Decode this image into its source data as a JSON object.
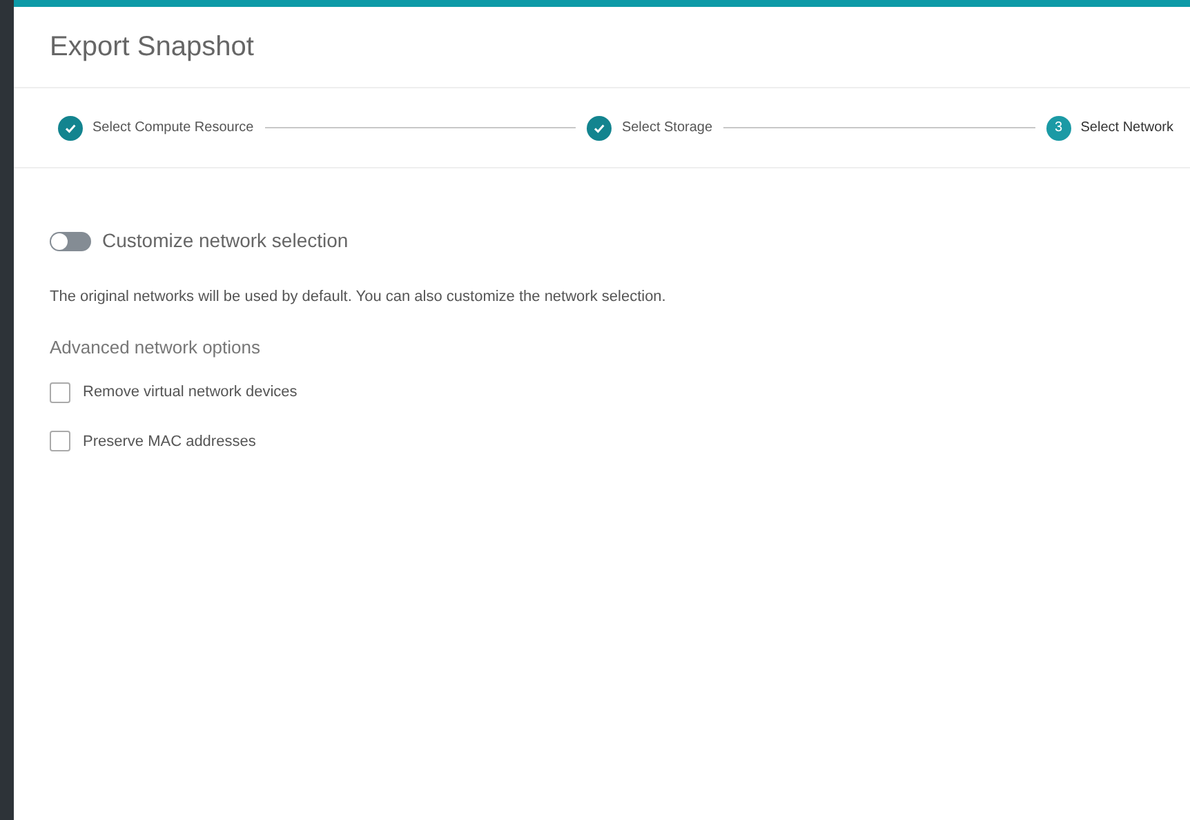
{
  "dialog": {
    "title": "Export Snapshot"
  },
  "steps": [
    {
      "label": "Select Compute Resource",
      "completed": true
    },
    {
      "label": "Select Storage",
      "completed": true
    },
    {
      "label": "Select Network",
      "completed": false,
      "number": "3"
    }
  ],
  "toggle": {
    "label": "Customize network selection",
    "on": false
  },
  "description": "The original networks will be used by default. You can also customize the network selection.",
  "advanced": {
    "heading": "Advanced network options",
    "options": [
      {
        "label": "Remove virtual network devices",
        "checked": false
      },
      {
        "label": "Preserve MAC addresses",
        "checked": false
      }
    ]
  }
}
